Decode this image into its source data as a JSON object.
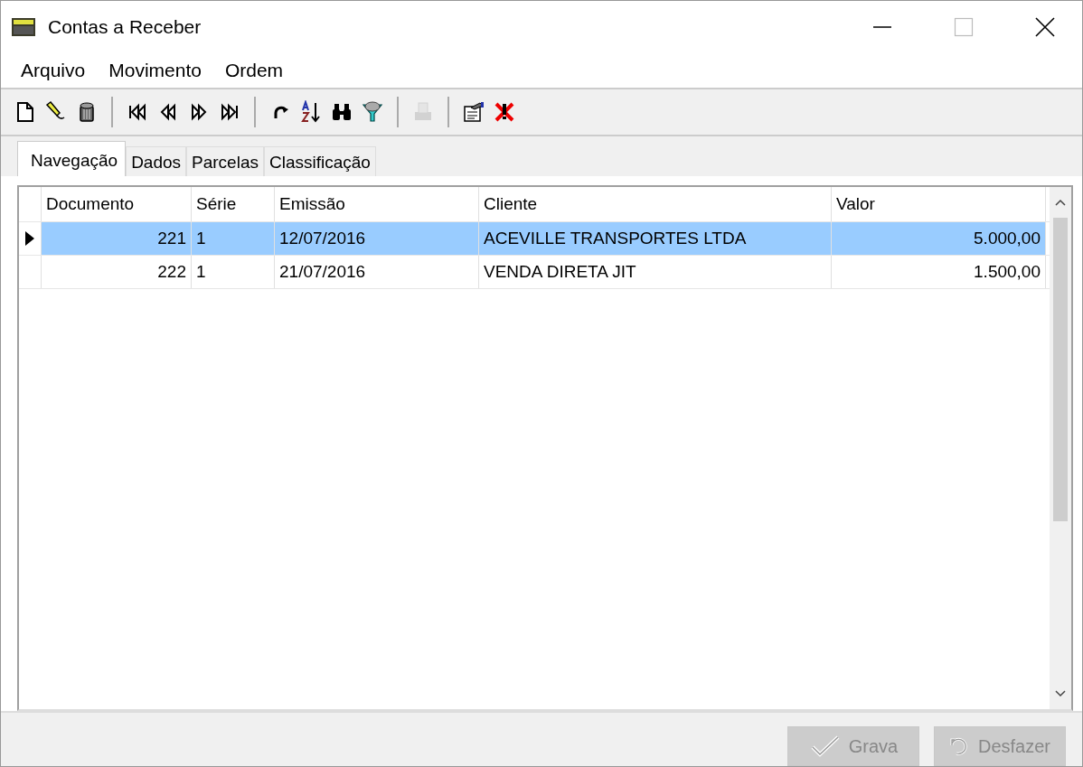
{
  "window": {
    "title": "Contas a Receber"
  },
  "menu": [
    "Arquivo",
    "Movimento",
    "Ordem"
  ],
  "toolbar": [
    [
      {
        "kind": "new",
        "disabled": false
      },
      {
        "kind": "edit",
        "disabled": false
      },
      {
        "kind": "delete",
        "disabled": false
      }
    ],
    [
      {
        "kind": "first",
        "disabled": false
      },
      {
        "kind": "prev",
        "disabled": false
      },
      {
        "kind": "next",
        "disabled": false
      },
      {
        "kind": "last",
        "disabled": false
      }
    ],
    [
      {
        "kind": "refresh",
        "disabled": false
      },
      {
        "kind": "sort",
        "disabled": false
      },
      {
        "kind": "find",
        "disabled": false
      },
      {
        "kind": "filter",
        "disabled": false
      }
    ],
    [
      {
        "kind": "print",
        "disabled": true
      }
    ],
    [
      {
        "kind": "properties",
        "disabled": false
      },
      {
        "kind": "close",
        "disabled": false
      }
    ]
  ],
  "tabs": [
    {
      "label": "Navegação",
      "selected": true
    },
    {
      "label": "Dados",
      "selected": false
    },
    {
      "label": "Parcelas",
      "selected": false
    },
    {
      "label": "Classificação",
      "selected": false
    }
  ],
  "table": {
    "columns": [
      "Documento",
      "Série",
      "Emissão",
      "Cliente",
      "Valor"
    ],
    "rows": [
      {
        "selected": true,
        "cells": [
          "221",
          "1",
          "12/07/2016",
          "ACEVILLE TRANSPORTES LTDA",
          "5.000,00"
        ]
      },
      {
        "selected": false,
        "cells": [
          "222",
          "1",
          "21/07/2016",
          "VENDA DIRETA JIT",
          "1.500,00"
        ]
      }
    ]
  },
  "buttons": [
    {
      "kind": "save",
      "label": "Grava",
      "disabled": true
    },
    {
      "kind": "undo",
      "label": "Desfazer",
      "disabled": true
    }
  ]
}
